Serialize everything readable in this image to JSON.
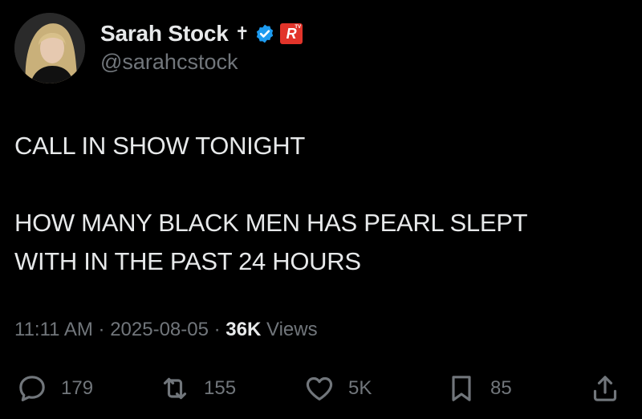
{
  "author": {
    "display_name": "Sarah Stock",
    "cross_glyph": "✝",
    "handle": "@sarahcstock",
    "verified_color": "#1d9bf0",
    "badge_letter": "R",
    "badge_sup": "TV",
    "badge_color": "#e2342a"
  },
  "tweet": {
    "text": "CALL IN SHOW TONIGHT\n\nHOW MANY BLACK MEN HAS PEARL SLEPT\nWITH IN THE PAST 24 HOURS"
  },
  "meta": {
    "time": "11:11 AM",
    "date": "2025-08-05",
    "separator": "·",
    "views_count": "36K",
    "views_label": "Views"
  },
  "actions": {
    "replies": "179",
    "reposts": "155",
    "likes": "5K",
    "bookmarks": "85"
  },
  "colors": {
    "background": "#000000",
    "primary_text": "#e7e9ea",
    "secondary_text": "#71767b"
  }
}
